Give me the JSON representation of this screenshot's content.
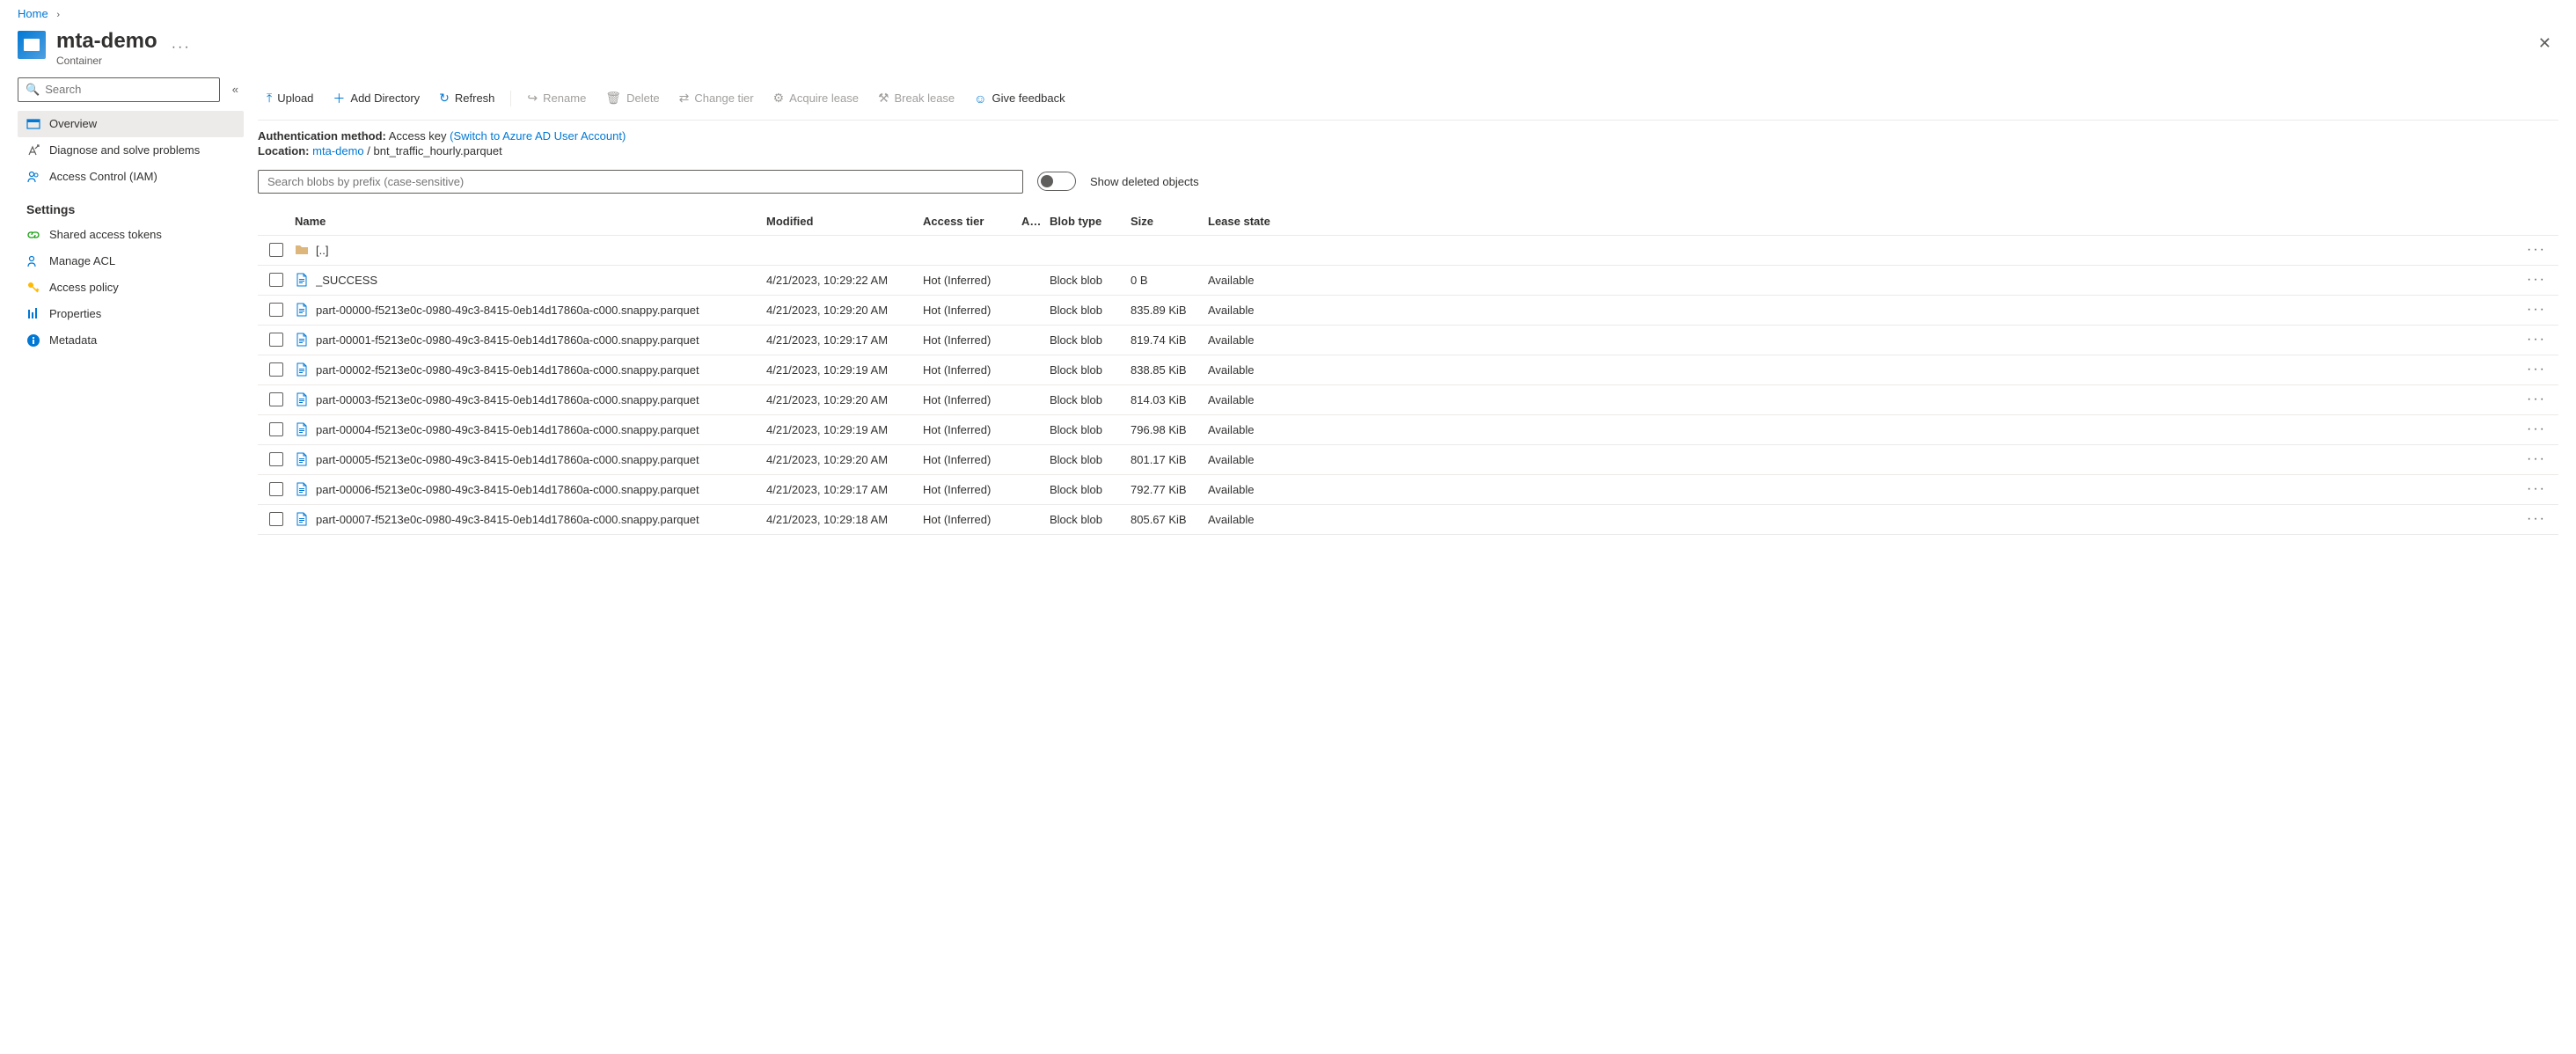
{
  "breadcrumb": {
    "home": "Home"
  },
  "header": {
    "title": "mta-demo",
    "subtitle": "Container"
  },
  "sidebar": {
    "search_placeholder": "Search",
    "nav": [
      {
        "label": "Overview",
        "icon": "overview-icon",
        "active": true
      },
      {
        "label": "Diagnose and solve problems",
        "icon": "diagnose-icon"
      },
      {
        "label": "Access Control (IAM)",
        "icon": "iam-icon"
      }
    ],
    "settings_title": "Settings",
    "settings": [
      {
        "label": "Shared access tokens",
        "icon": "link-icon"
      },
      {
        "label": "Manage ACL",
        "icon": "acl-icon"
      },
      {
        "label": "Access policy",
        "icon": "key-icon"
      },
      {
        "label": "Properties",
        "icon": "properties-icon"
      },
      {
        "label": "Metadata",
        "icon": "info-icon"
      }
    ]
  },
  "toolbar": {
    "upload": "Upload",
    "add_directory": "Add Directory",
    "refresh": "Refresh",
    "rename": "Rename",
    "delete": "Delete",
    "change_tier": "Change tier",
    "acquire_lease": "Acquire lease",
    "break_lease": "Break lease",
    "give_feedback": "Give feedback"
  },
  "info": {
    "auth_label": "Authentication method:",
    "auth_value": "Access key",
    "auth_switch": "(Switch to Azure AD User Account)",
    "location_label": "Location:",
    "location_root": "mta-demo",
    "location_sep": " / ",
    "location_current": "bnt_traffic_hourly.parquet"
  },
  "blob_search_placeholder": "Search blobs by prefix (case-sensitive)",
  "show_deleted": "Show deleted objects",
  "columns": {
    "name": "Name",
    "modified": "Modified",
    "access_tier": "Access tier",
    "a": "A…",
    "blob_type": "Blob type",
    "size": "Size",
    "lease": "Lease state"
  },
  "parent_dir": "[..]",
  "rows": [
    {
      "name": "_SUCCESS",
      "modified": "4/21/2023, 10:29:22 AM",
      "tier": "Hot (Inferred)",
      "blob_type": "Block blob",
      "size": "0 B",
      "lease": "Available"
    },
    {
      "name": "part-00000-f5213e0c-0980-49c3-8415-0eb14d17860a-c000.snappy.parquet",
      "modified": "4/21/2023, 10:29:20 AM",
      "tier": "Hot (Inferred)",
      "blob_type": "Block blob",
      "size": "835.89 KiB",
      "lease": "Available"
    },
    {
      "name": "part-00001-f5213e0c-0980-49c3-8415-0eb14d17860a-c000.snappy.parquet",
      "modified": "4/21/2023, 10:29:17 AM",
      "tier": "Hot (Inferred)",
      "blob_type": "Block blob",
      "size": "819.74 KiB",
      "lease": "Available"
    },
    {
      "name": "part-00002-f5213e0c-0980-49c3-8415-0eb14d17860a-c000.snappy.parquet",
      "modified": "4/21/2023, 10:29:19 AM",
      "tier": "Hot (Inferred)",
      "blob_type": "Block blob",
      "size": "838.85 KiB",
      "lease": "Available"
    },
    {
      "name": "part-00003-f5213e0c-0980-49c3-8415-0eb14d17860a-c000.snappy.parquet",
      "modified": "4/21/2023, 10:29:20 AM",
      "tier": "Hot (Inferred)",
      "blob_type": "Block blob",
      "size": "814.03 KiB",
      "lease": "Available"
    },
    {
      "name": "part-00004-f5213e0c-0980-49c3-8415-0eb14d17860a-c000.snappy.parquet",
      "modified": "4/21/2023, 10:29:19 AM",
      "tier": "Hot (Inferred)",
      "blob_type": "Block blob",
      "size": "796.98 KiB",
      "lease": "Available"
    },
    {
      "name": "part-00005-f5213e0c-0980-49c3-8415-0eb14d17860a-c000.snappy.parquet",
      "modified": "4/21/2023, 10:29:20 AM",
      "tier": "Hot (Inferred)",
      "blob_type": "Block blob",
      "size": "801.17 KiB",
      "lease": "Available"
    },
    {
      "name": "part-00006-f5213e0c-0980-49c3-8415-0eb14d17860a-c000.snappy.parquet",
      "modified": "4/21/2023, 10:29:17 AM",
      "tier": "Hot (Inferred)",
      "blob_type": "Block blob",
      "size": "792.77 KiB",
      "lease": "Available"
    },
    {
      "name": "part-00007-f5213e0c-0980-49c3-8415-0eb14d17860a-c000.snappy.parquet",
      "modified": "4/21/2023, 10:29:18 AM",
      "tier": "Hot (Inferred)",
      "blob_type": "Block blob",
      "size": "805.67 KiB",
      "lease": "Available"
    }
  ]
}
